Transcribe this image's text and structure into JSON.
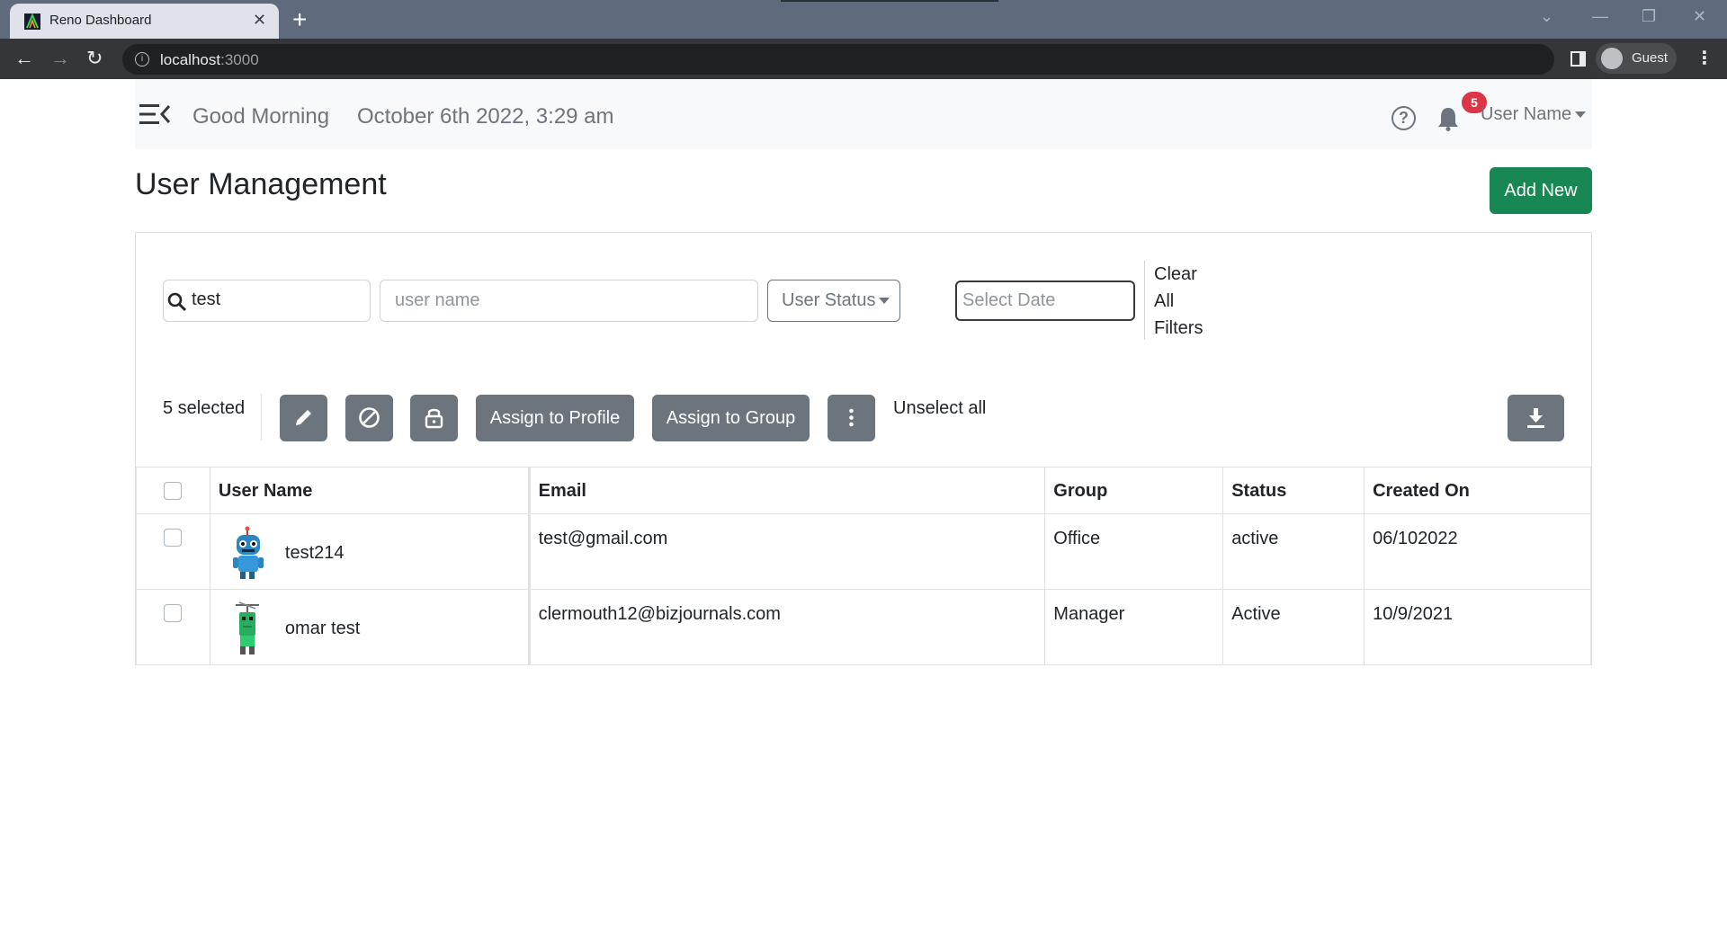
{
  "browser": {
    "tab_title": "Reno Dashboard",
    "url_host": "localhost",
    "url_port": ":3000",
    "profile_label": "Guest"
  },
  "header": {
    "greeting": "Good Morning",
    "datetime": "October 6th 2022, 3:29 am",
    "notification_count": "5",
    "user_menu": "User Name"
  },
  "page": {
    "title": "User Management",
    "add_new_label": "Add New"
  },
  "filters": {
    "search_value": "test",
    "username_placeholder": "user name",
    "status_label": "User Status",
    "date_placeholder": "Select Date",
    "clear_line1": "Clear",
    "clear_line2": "All",
    "clear_line3": "Filters"
  },
  "bulk": {
    "selected_text": "5 selected",
    "assign_profile_label": "Assign to Profile",
    "assign_group_label": "Assign to Group",
    "unselect_label": "Unselect all"
  },
  "table": {
    "headers": [
      "User Name",
      "Email",
      "Group",
      "Status",
      "Created On"
    ],
    "rows": [
      {
        "user": "test214",
        "email": "test@gmail.com",
        "group": "Office",
        "status": "active",
        "created": "06/102022"
      },
      {
        "user": "omar test",
        "email": "clermouth12@bizjournals.com",
        "group": "Manager",
        "status": "Active",
        "created": "10/9/2021"
      }
    ]
  },
  "colors": {
    "primary_success": "#198754",
    "secondary": "#6c757d",
    "badge_danger": "#dc3545"
  }
}
